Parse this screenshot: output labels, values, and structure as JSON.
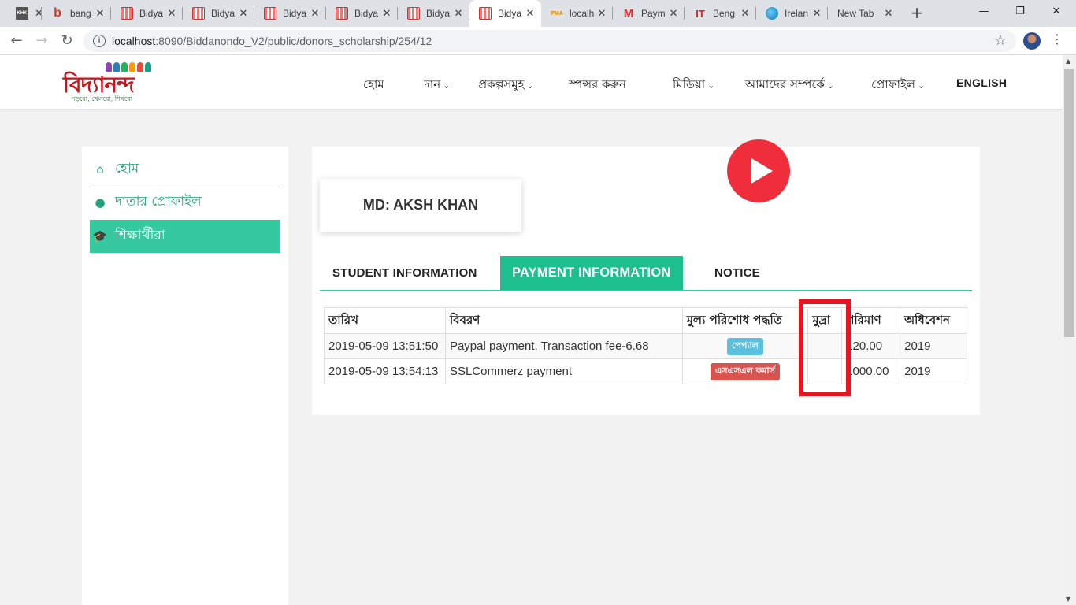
{
  "browser": {
    "tabs": [
      {
        "title": "",
        "favicon": "khk"
      },
      {
        "title": "bang",
        "favicon": "b"
      },
      {
        "title": "Bidya",
        "favicon": "bidya"
      },
      {
        "title": "Bidya",
        "favicon": "bidya"
      },
      {
        "title": "Bidya",
        "favicon": "bidya"
      },
      {
        "title": "Bidya",
        "favicon": "bidya"
      },
      {
        "title": "Bidya",
        "favicon": "bidya"
      },
      {
        "title": "Bidya",
        "favicon": "bidya",
        "active": true
      },
      {
        "title": "localh",
        "favicon": "pma"
      },
      {
        "title": "Paym",
        "favicon": "gmail"
      },
      {
        "title": "Beng",
        "favicon": "it"
      },
      {
        "title": "Irelan",
        "favicon": "globe"
      },
      {
        "title": "New Tab",
        "favicon": "none"
      }
    ],
    "url_host": "localhost",
    "url_path": ":8090/Biddanondo_V2/public/donors_scholarship/254/12"
  },
  "site": {
    "logo_text": "বিদ্যানন্দ",
    "logo_tagline": "পড়বো, খেলবো, শিখবো",
    "menu": [
      {
        "label": "হোম",
        "dropdown": false
      },
      {
        "label": "দান",
        "dropdown": true
      },
      {
        "label": "প্রকল্পসমুহ",
        "dropdown": true
      },
      {
        "label": "স্পন্সর করুন",
        "dropdown": false
      },
      {
        "label": "মিডিয়া",
        "dropdown": true
      },
      {
        "label": "আমাদের সম্পর্কে",
        "dropdown": true
      },
      {
        "label": "প্রোফাইল",
        "dropdown": true
      },
      {
        "label": "ENGLISH",
        "dropdown": false
      }
    ]
  },
  "sidebar": {
    "items": [
      {
        "label": "হোম",
        "icon": "home-icon",
        "active": false
      },
      {
        "label": "দাতার প্রোফাইল",
        "icon": "user-icon",
        "active": false
      },
      {
        "label": "শিক্ষার্থীরা",
        "icon": "graduation-cap-icon",
        "active": true
      }
    ]
  },
  "donor": {
    "name": "MD: AKSH KHAN"
  },
  "tabs": [
    {
      "label": "STUDENT INFORMATION",
      "active": false
    },
    {
      "label": "PAYMENT INFORMATION",
      "active": true
    },
    {
      "label": "NOTICE",
      "active": false
    }
  ],
  "payments": {
    "headers": [
      "তারিখ",
      "বিবরণ",
      "মুল্য পরিশোধ পদ্ধতি",
      "মুদ্রা",
      "পরিমাণ",
      "অধিবেশন"
    ],
    "rows": [
      {
        "date": "2019-05-09 13:51:50",
        "description": "Paypal payment. Transaction fee-6.68",
        "method": "পেপ্যাল",
        "currency": "",
        "amount": "120.00",
        "session": "2019"
      },
      {
        "date": "2019-05-09 13:54:13",
        "description": "SSLCommerz payment",
        "method": "এসএসএল কমার্স",
        "currency": "",
        "amount": "1000.00",
        "session": "2019"
      }
    ]
  },
  "colors": {
    "brand_green": "#1ebf8f",
    "brand_red": "#c4161c",
    "highlight_red": "#e8141f",
    "paypal_badge": "#5bc0de",
    "ssl_badge": "#d9534f"
  }
}
